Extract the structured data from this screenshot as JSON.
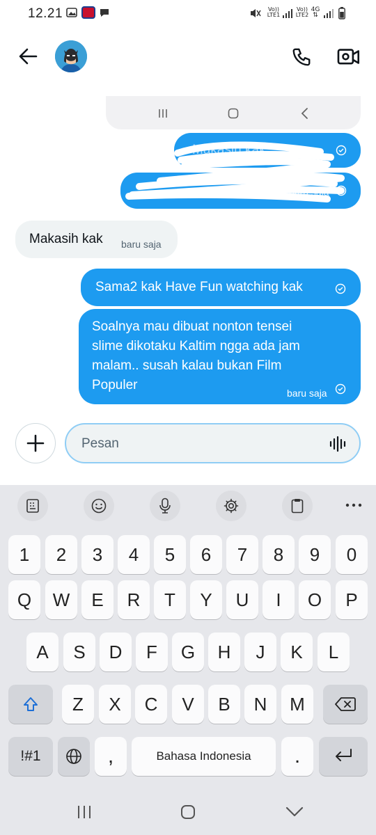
{
  "status_bar": {
    "time": "12.21",
    "sim1_top": "Vo))",
    "sim1_bottom": "LTE1",
    "sim2_top": "Vo))",
    "sim2_bottom": "LTE2",
    "network": "4G"
  },
  "messages": [
    {
      "direction": "out",
      "text": "Makasih kak",
      "redacted": true
    },
    {
      "direction": "out",
      "text": "baru saja",
      "redacted": true
    },
    {
      "direction": "in",
      "text": "Makasih kak",
      "time": "baru saja"
    },
    {
      "direction": "out",
      "text": "Sama2 kak Have Fun watching kak"
    },
    {
      "direction": "out",
      "lines": [
        "Soalnya mau dibuat nonton tensei",
        "slime dikotaku Kaltim ngga ada jam",
        "malam.. susah kalau bukan Film",
        "Populer"
      ],
      "time": "baru saja"
    }
  ],
  "composer": {
    "placeholder": "Pesan"
  },
  "keyboard": {
    "numbers": [
      "1",
      "2",
      "3",
      "4",
      "5",
      "6",
      "7",
      "8",
      "9",
      "0"
    ],
    "row1": [
      "Q",
      "W",
      "E",
      "R",
      "T",
      "Y",
      "U",
      "I",
      "O",
      "P"
    ],
    "row2": [
      "A",
      "S",
      "D",
      "F",
      "G",
      "H",
      "J",
      "K",
      "L"
    ],
    "row3": [
      "Z",
      "X",
      "C",
      "V",
      "B",
      "N",
      "M"
    ],
    "symbols_label": "!#1",
    "comma": ",",
    "space_label": "Bahasa Indonesia",
    "period": "."
  },
  "colors": {
    "accent": "#1d9bf0",
    "incoming": "#eff3f4",
    "keyboard_bg": "#e6e7eb"
  }
}
